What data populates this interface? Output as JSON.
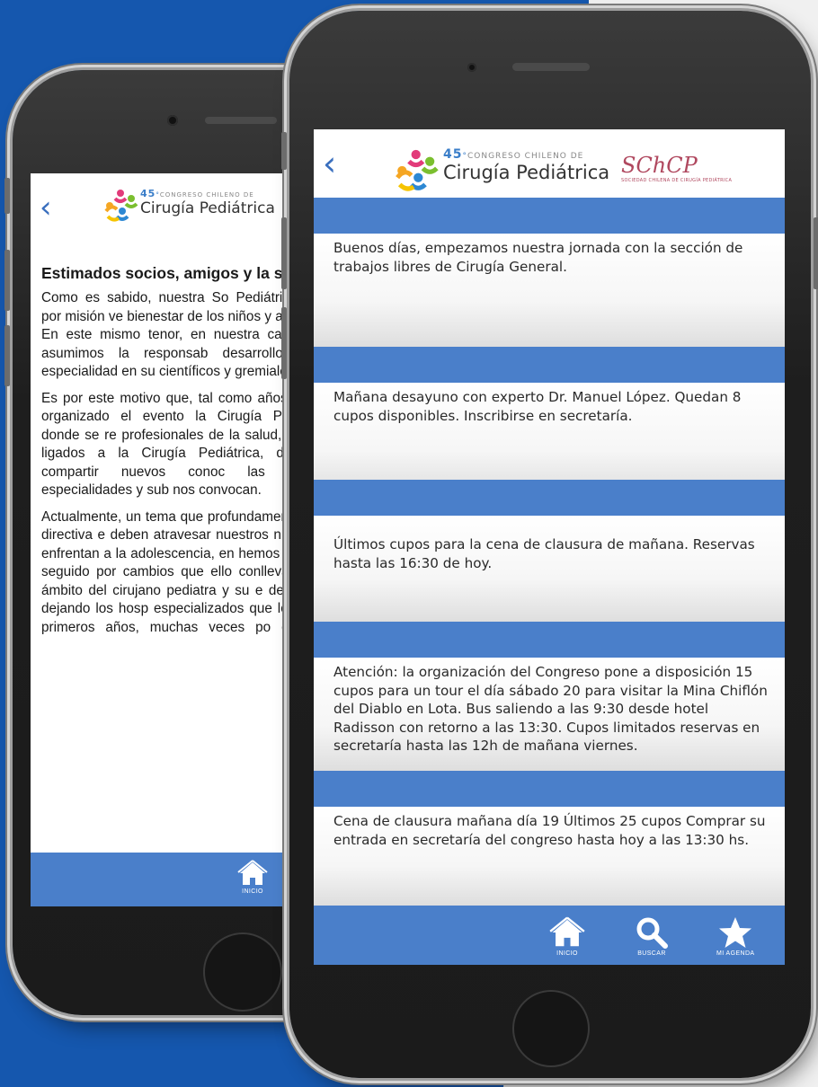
{
  "colors": {
    "background_blue": "#1557ae",
    "accent_blue": "#4a7fca",
    "logo_blue": "#3a7ec9",
    "society_red": "#b0485f"
  },
  "logo": {
    "edition": "45",
    "ordinal": "°",
    "congress_line": "CONGRESO CHILENO DE",
    "main": "Cirugía Pediátrica"
  },
  "society": {
    "acronym": "SChCP",
    "subtitle": "SOCIEDAD CHILENA DE CIRUGÍA PEDIÁTRICA"
  },
  "back_phone": {
    "back_icon": "chevron-left-icon",
    "letter": {
      "heading": "Estimados socios, amigos y la salud,",
      "paragraphs": [
        "Como es sabido, nuestra So Pediátrica, tiene por misión ve bienestar de los niños y adolescen En este mismo tenor, en nuestra ca médica, asumimos la responsab desarrollo de la especialidad en su científicos y gremiales.",
        "Es por este motivo que, tal como años, hemos organizado el evento la Cirugía Pediátrica, donde se re profesionales de la salud, nacional ligados a la Cirugía Pediátrica, debatir y compartir nuevos conoc las distintas especialidades y sub nos convocan.",
        "Actualmente, un tema que profundamente como directiva e deben atravesar nuestros niños y se enfrentan a la adolescencia, en hemos tratado y seguido por cambios que ello conlleva, deben ámbito del cirujano pediatra y su e de adultos, dejando los hosp especializados que los atendi primeros años, muchas veces po clínica y debiendo pasar por el tr"
      ]
    },
    "nav": [
      {
        "label": "INICIO",
        "icon": "home-icon"
      }
    ]
  },
  "front_phone": {
    "back_icon": "chevron-left-icon",
    "messages": [
      {
        "text": "Buenos días, empezamos nuestra jornada con la sección de trabajos libres de Cirugía General."
      },
      {
        "text": "Mañana desayuno con experto Dr. Manuel López. Quedan 8 cupos disponibles. Inscribirse en secretaría."
      },
      {
        "text": "Últimos cupos para la cena de clausura de mañana. Reservas hasta las 16:30 de hoy."
      },
      {
        "text": "Atención: la organización del Congreso pone a disposición 15 cupos para un tour el día sábado 20 para visitar la Mina Chiflón del Diablo en Lota. Bus saliendo a las 9:30 desde hotel Radisson con retorno a las 13:30. Cupos limitados reservas en secretaría hasta las 12h de mañana viernes."
      },
      {
        "text": "Cena de clausura mañana día 19 Últimos 25 cupos Comprar su entrada en secretaría del congreso hasta hoy a las 13:30 hs."
      }
    ],
    "nav": [
      {
        "label": "INICIO",
        "icon": "home-icon"
      },
      {
        "label": "BUSCAR",
        "icon": "search-icon"
      },
      {
        "label": "MI AGENDA",
        "icon": "star-icon"
      }
    ]
  }
}
